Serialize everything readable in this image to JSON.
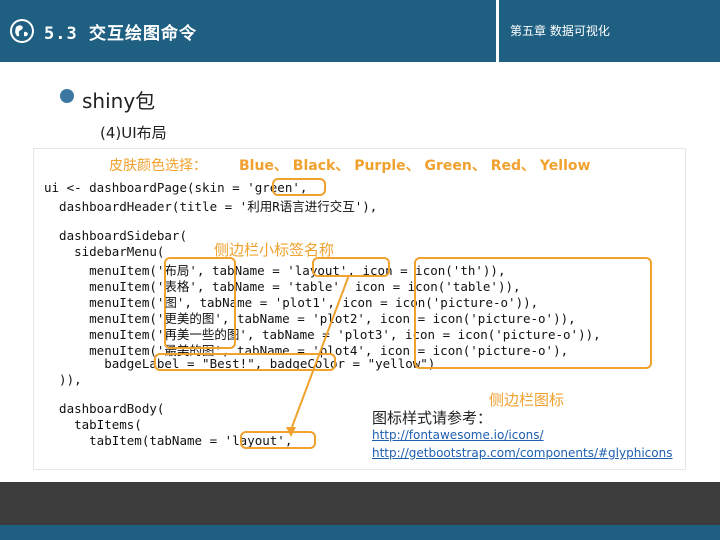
{
  "header": {
    "title": "5.3 交互绘图命令",
    "chapter": "第五章 数据可视化",
    "logo_icon": "globe-icon"
  },
  "content": {
    "bullet": "shiny包",
    "subheading": "(4)UI布局"
  },
  "code_image": {
    "skin_label": "皮肤颜色选择：",
    "skin_values": "Blue、 Black、 Purple、 Green、 Red、 Yellow",
    "annotation_sidebar_names": "侧边栏小标签名称",
    "annotation_sidebar_icons": "侧边栏图标",
    "icon_ref_title": "图标样式请参考：",
    "link_fontawesome": "http://fontawesome.io/icons/",
    "link_glyphicons": "http://getbootstrap.com/components/#glyphicons",
    "code_lines": [
      "ui <- dashboardPage(skin = 'green',",
      "  dashboardHeader(title = '利用R语言进行交互'),",
      "",
      "  dashboardSidebar(",
      "    sidebarMenu(",
      "      menuItem('布局', tabName = 'layout', icon = icon('th')),",
      "      menuItem('表格', tabName = 'table', icon = icon('table')),",
      "      menuItem('图', tabName = 'plot1', icon = icon('picture-o')),",
      "      menuItem('更美的图', tabName = 'plot2', icon = icon('picture-o')),",
      "      menuItem('再美一些的图', tabName = 'plot3', icon = icon('picture-o')),",
      "      menuItem('最美的图', tabName = 'plot4', icon = icon('picture-o'),",
      "        badgeLabel = \"Best!\", badgeColor = \"yellow\")",
      "  )),",
      "",
      "  dashboardBody(",
      "    tabItems(",
      "      tabItem(tabName = 'layout',"
    ]
  },
  "colors": {
    "header_bg": "#1e5f82",
    "accent_orange": "#f0a12e",
    "footer_dark": "#3c3c3c"
  }
}
